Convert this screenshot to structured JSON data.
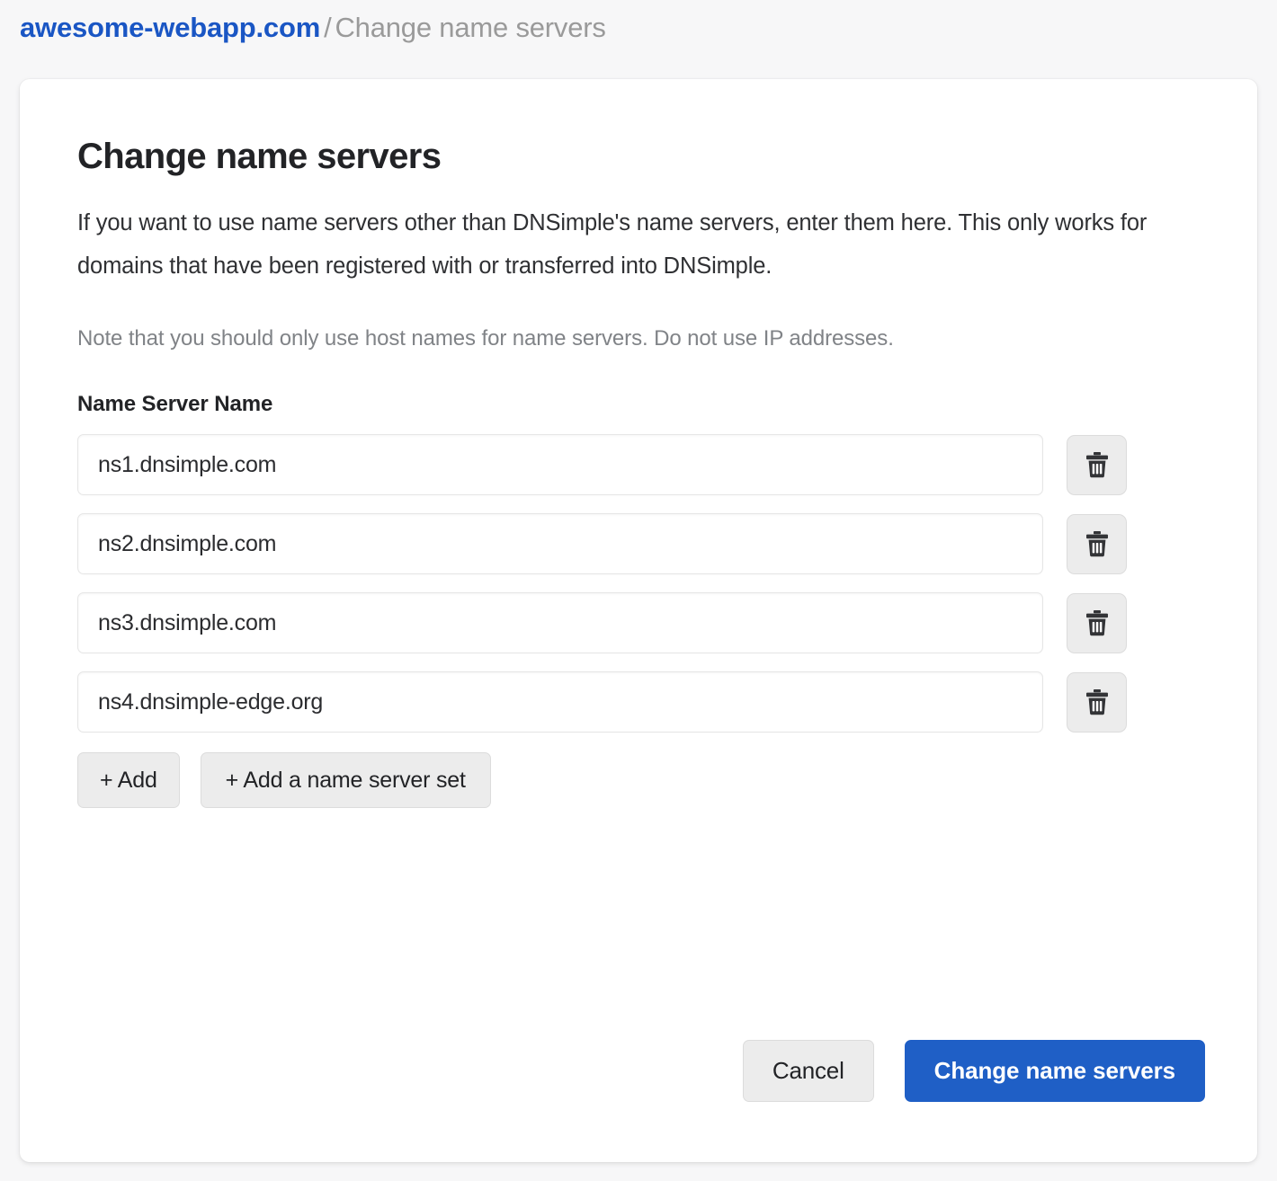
{
  "breadcrumb": {
    "domain": "awesome-webapp.com",
    "separator": "/",
    "current": "Change name servers",
    "link_color": "#1a56c4",
    "muted_color": "#9a9a9a"
  },
  "card": {
    "title": "Change name servers",
    "intro": "If you want to use name servers other than DNSimple's name servers, enter them here. This only works for domains that have been registered with or transferred into DNSimple.",
    "note": "Note that you should only use host names for name servers. Do not use IP addresses.",
    "field_label": "Name Server Name"
  },
  "name_servers": [
    {
      "value": "ns1.dnsimple.com",
      "placeholder": "",
      "delete_icon": "trash-icon"
    },
    {
      "value": "ns2.dnsimple.com",
      "placeholder": "",
      "delete_icon": "trash-icon"
    },
    {
      "value": "ns3.dnsimple.com",
      "placeholder": "",
      "delete_icon": "trash-icon"
    },
    {
      "value": "ns4.dnsimple-edge.org",
      "placeholder": "",
      "delete_icon": "trash-icon"
    }
  ],
  "add_buttons": {
    "add": "+ Add",
    "add_set": "+ Add a name server set"
  },
  "footer": {
    "cancel": "Cancel",
    "submit": "Change name servers",
    "primary_color": "#1f5fc6"
  }
}
